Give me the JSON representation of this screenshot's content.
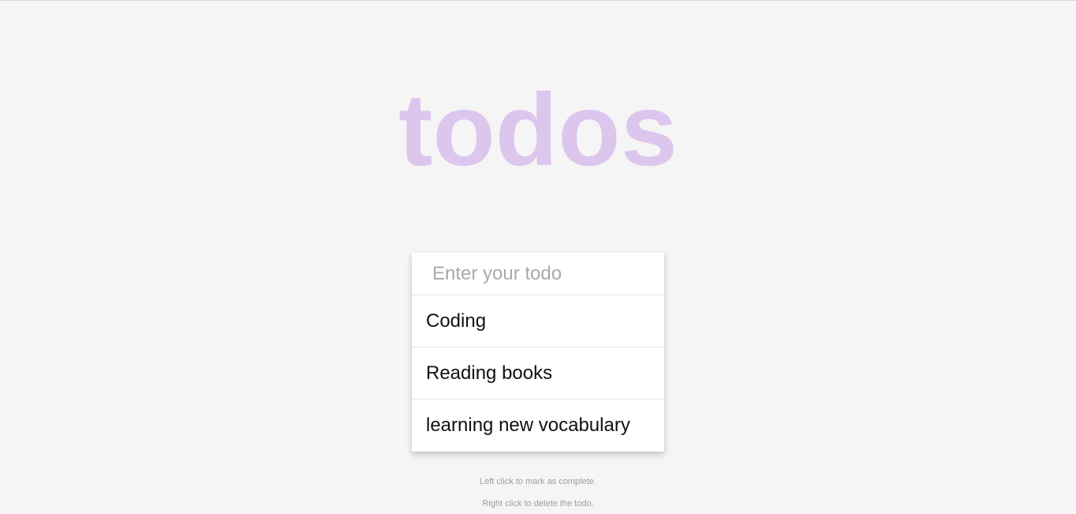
{
  "app": {
    "title": "todos",
    "title_color": "#dcc6ee"
  },
  "input": {
    "placeholder": "Enter your todo",
    "value": ""
  },
  "todos": [
    {
      "label": "Coding"
    },
    {
      "label": "Reading books"
    },
    {
      "label": "learning new vocabulary"
    }
  ],
  "hints": {
    "left_click": "Left click to mark as complete.",
    "right_click": "Right click to delete the todo."
  }
}
